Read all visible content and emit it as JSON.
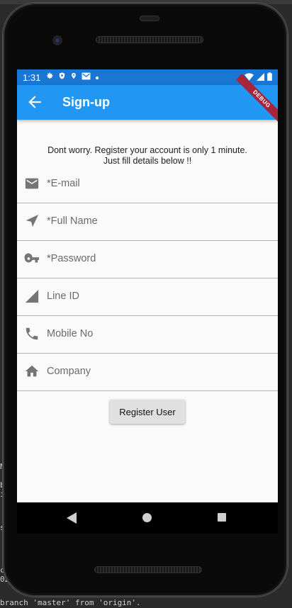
{
  "status_bar": {
    "time": "1:31",
    "icons": [
      "settings-icon",
      "shield-icon",
      "location-icon",
      "gmail-icon",
      "dot-icon",
      "wifi-icon",
      "signal-icon",
      "battery-icon"
    ]
  },
  "app_bar": {
    "title": "Sign-up",
    "debug_label": "DEBUG",
    "color": "#2196f3",
    "status_color": "#1976d2"
  },
  "intro": {
    "line1": "Dont worry. Register your account is only 1 minute.",
    "line2": "Just fill details below !!"
  },
  "form": {
    "fields": [
      {
        "placeholder": "*E-mail",
        "value": "",
        "icon": "email-icon"
      },
      {
        "placeholder": "*Full Name",
        "value": "",
        "icon": "navigation-icon"
      },
      {
        "placeholder": "*Password",
        "value": "",
        "icon": "key-icon"
      },
      {
        "placeholder": "Line ID",
        "value": "",
        "icon": "signal-triangle-icon"
      },
      {
        "placeholder": "Mobile No",
        "value": "",
        "icon": "phone-icon"
      },
      {
        "placeholder": "Company",
        "value": "",
        "icon": "home-icon"
      }
    ],
    "submit_label": "Register User"
  },
  "background": {
    "line1": "N",
    "line2": "b",
    "line3": "ir",
    "line4": "s",
    "line5": "co",
    "line6": "02",
    "bottom_text": "branch 'master' from 'origin'."
  }
}
